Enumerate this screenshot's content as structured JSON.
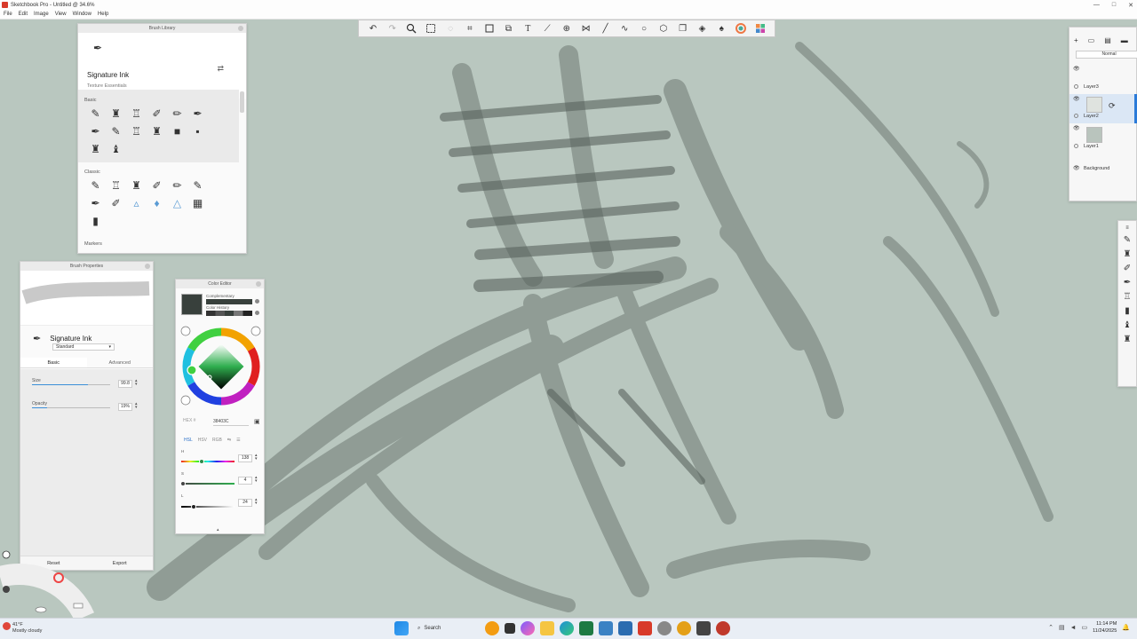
{
  "window": {
    "title": "Sketchbook Pro - Untitled @ 34.6%",
    "controls": [
      "—",
      "□",
      "✕"
    ]
  },
  "menu": [
    "File",
    "Edit",
    "Image",
    "View",
    "Window",
    "Help"
  ],
  "brush_library": {
    "title": "Brush Library",
    "brush_name": "Signature Ink",
    "brush_set": "Texture Essentials",
    "section_basic": "Basic",
    "section_classic": "Classic",
    "section_markers": "Markers"
  },
  "brush_properties": {
    "title": "Brush Properties",
    "brush_name": "Signature Ink",
    "preset": "Standard",
    "tab_basic": "Basic",
    "tab_advanced": "Advanced",
    "size_label": "Size",
    "size_value": "99.8",
    "size_fraction": 0.72,
    "opacity_label": "Opacity",
    "opacity_value": "19%",
    "opacity_fraction": 0.19,
    "reset_label": "Reset",
    "export_label": "Export"
  },
  "color_editor": {
    "title": "Color Editor",
    "swatch_color": "#38403c",
    "complementary_label": "Complementary",
    "history_label": "Color History",
    "hex_label": "HEX #",
    "hex_value": "38403C",
    "modes": [
      "HSL",
      "HSV",
      "RGB"
    ],
    "active_mode": "HSL",
    "h_label": "H",
    "h_value": "138",
    "h_fraction": 0.38,
    "s_label": "S",
    "s_value": "4",
    "s_fraction": 0.04,
    "l_label": "L",
    "l_value": "24",
    "l_fraction": 0.24
  },
  "layers": {
    "blend_mode": "Normal",
    "items": [
      "Layer3",
      "Layer2",
      "Layer1",
      "Background"
    ],
    "selected": "Layer2"
  },
  "taskbar": {
    "temperature": "41°F",
    "weather": "Mostly cloudy",
    "search_label": "Search",
    "time": "11:14 PM",
    "date": "11/24/2025"
  },
  "colors": {
    "canvas": "#b9c7bf",
    "accent": "#2a7ad8",
    "app_icon": "#d83a2a"
  }
}
